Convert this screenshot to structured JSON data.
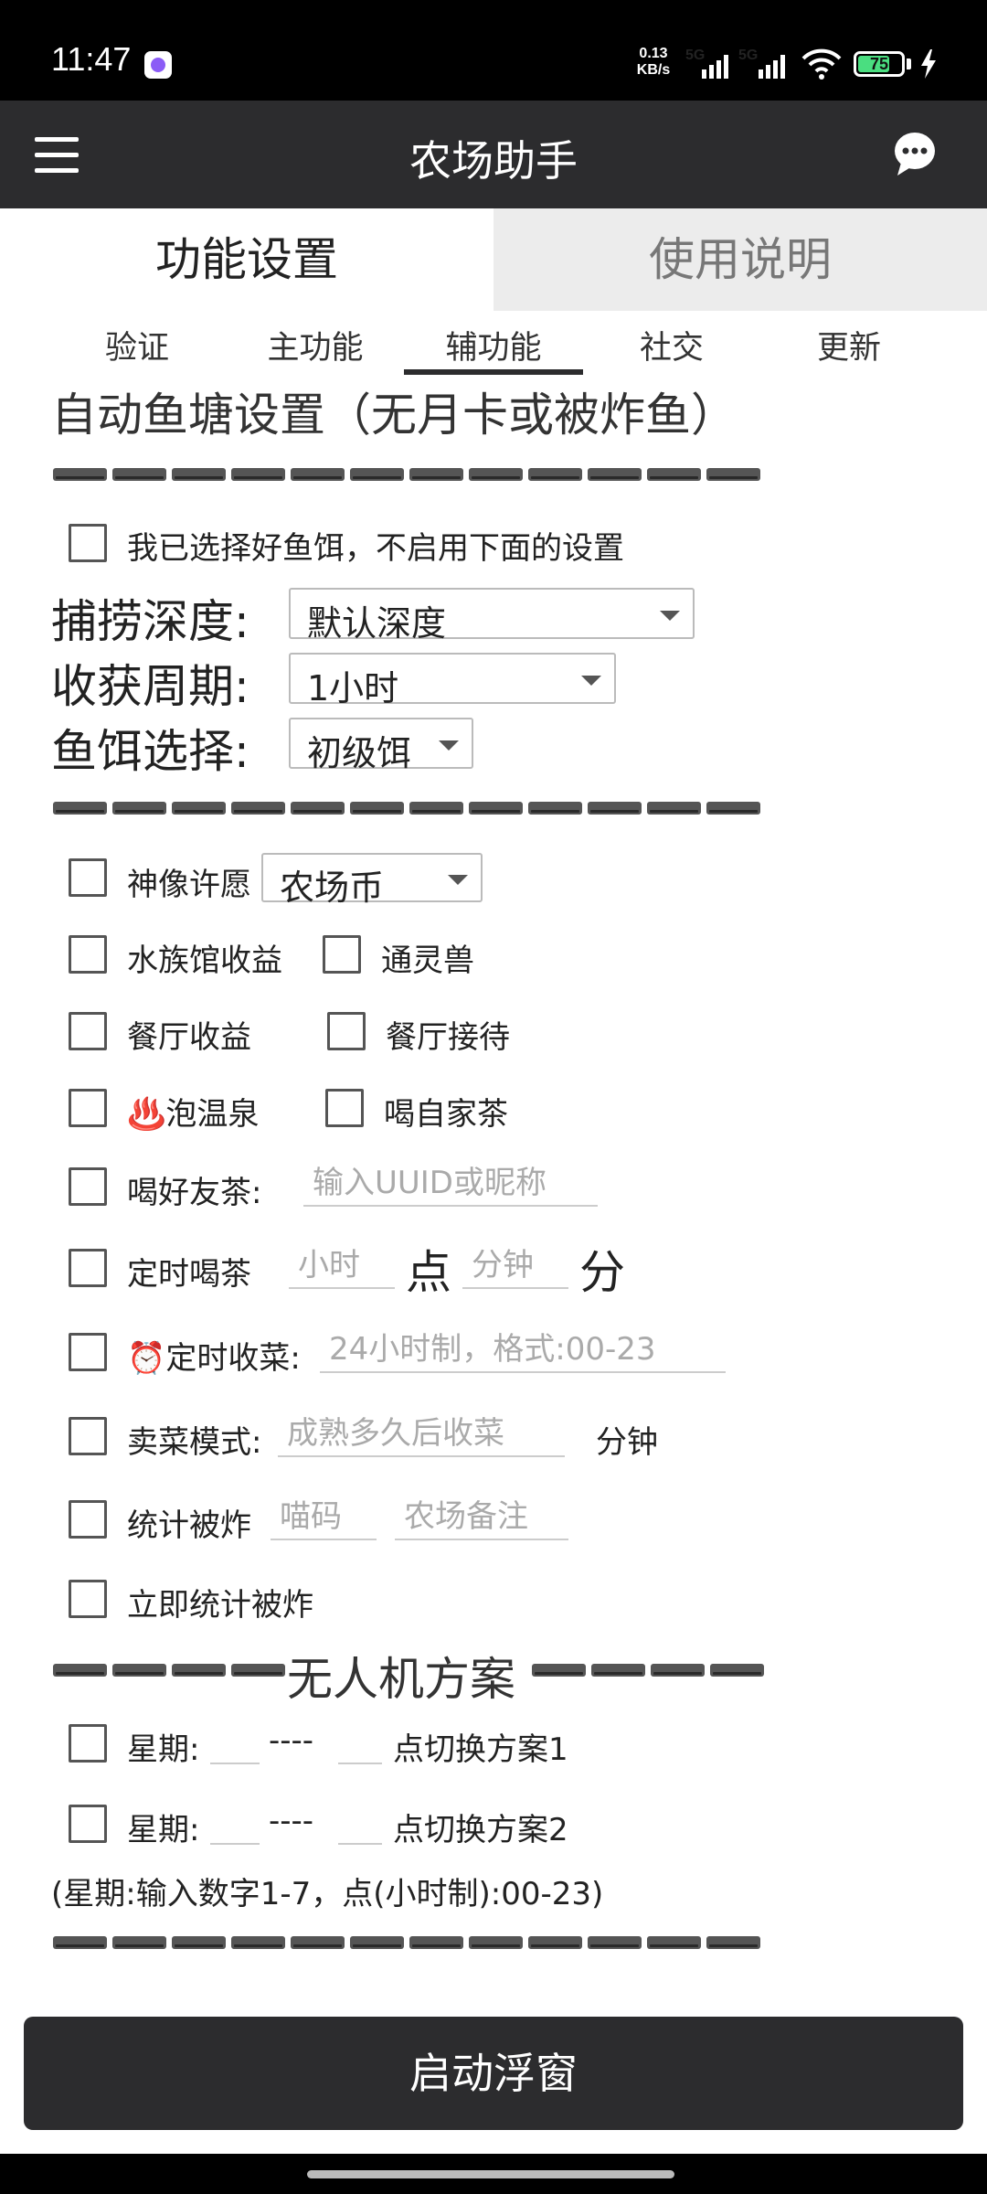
{
  "status_bar": {
    "time": "11:47",
    "net_speed_value": "0.13",
    "net_speed_unit": "KB/s",
    "sim1": "5G",
    "sim2": "5G",
    "battery": "75",
    "battery_level": 0.75,
    "icons": [
      "app-notification-icon",
      "wifi-icon",
      "battery-icon",
      "charging-icon"
    ]
  },
  "header": {
    "title": "农场助手",
    "menu_icon": "hamburger-menu-icon",
    "chat_icon": "chat-bubble-icon"
  },
  "tabs": [
    {
      "label": "功能设置",
      "active": true
    },
    {
      "label": "使用说明",
      "active": false
    }
  ],
  "subtabs": [
    {
      "label": "验证"
    },
    {
      "label": "主功能"
    },
    {
      "label": "辅功能",
      "active": true
    },
    {
      "label": "社交"
    },
    {
      "label": "更新"
    }
  ],
  "pond": {
    "title": "自动鱼塘设置（无月卡或被炸鱼）",
    "skip_label": "我已选择好鱼饵，不启用下面的设置",
    "depth_label": "捕捞深度:",
    "depth_value": "默认深度",
    "period_label": "收获周期:",
    "period_value": "1小时",
    "bait_label": "鱼饵选择:",
    "bait_value": "初级饵"
  },
  "options": {
    "wish_label": "神像许愿",
    "wish_value": "农场币",
    "aquarium_label": "水族馆收益",
    "spirit_label": "通灵兽",
    "restaurant_label": "餐厅收益",
    "reception_label": "餐厅接待",
    "hotspring_emoji": "♨️",
    "hotspring_label": "泡温泉",
    "own_tea_label": "喝自家茶",
    "friend_tea_label": "喝好友茶:",
    "friend_tea_placeholder": "输入UUID或昵称",
    "timed_tea_label": "定时喝茶",
    "hour_placeholder": "小时",
    "dian": "点",
    "minute_placeholder": "分钟",
    "fen": "分",
    "harvest_emoji": "⏰",
    "timed_harvest_label": "定时收菜:",
    "timed_harvest_placeholder": "24小时制，格式:00-23",
    "sell_label": "卖菜模式:",
    "sell_placeholder": "成熟多久后收菜",
    "sell_unit": "分钟",
    "stats_label": "统计被炸",
    "stats_code_placeholder": "喵码",
    "stats_note_placeholder": "农场备注",
    "stats_now_label": "立即统计被炸"
  },
  "drone": {
    "title": "无人机方案",
    "weekday_label": "星期:",
    "dashes": "----",
    "plan1_label": "点切换方案1",
    "plan2_label": "点切换方案2",
    "hint": "(星期:输入数字1-7，点(小时制):00-23)"
  },
  "start_button": "启动浮窗"
}
